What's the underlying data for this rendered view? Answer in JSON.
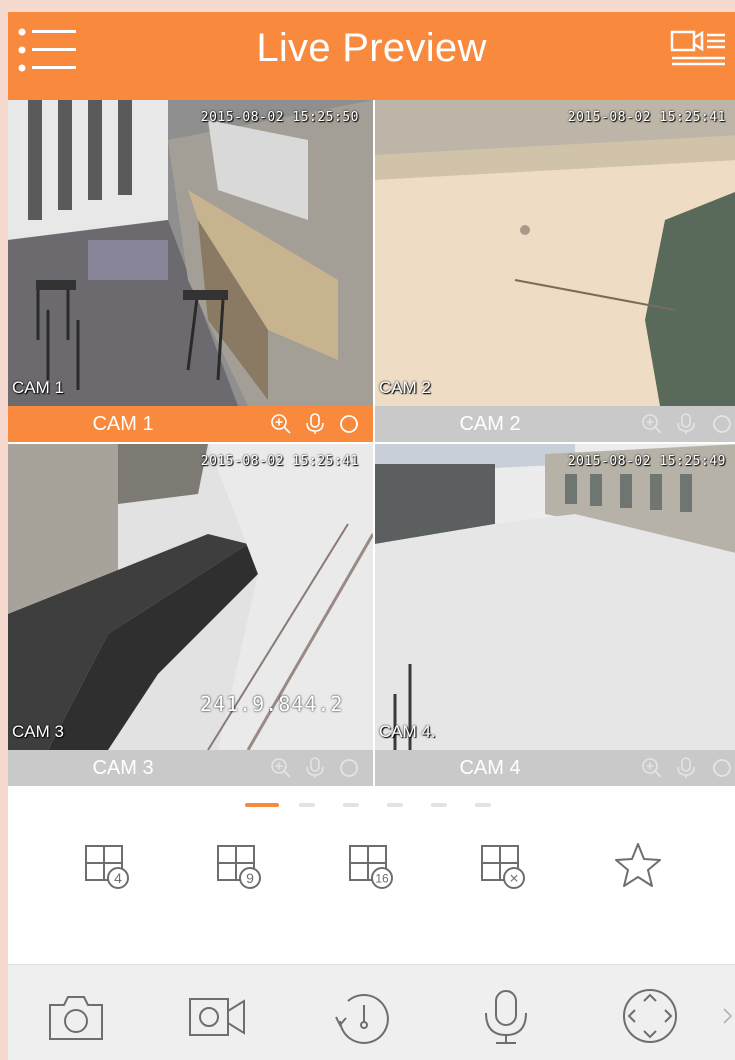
{
  "header": {
    "title": "Live Preview",
    "menu_icon": "hamburger-menu-icon",
    "right_icon": "video-playback-list-icon"
  },
  "colors": {
    "accent": "#f8893d",
    "inactive_bar": "#c9c9c9",
    "icon_gray": "#6e6e6e"
  },
  "cameras": [
    {
      "name": "CAM 1",
      "osd_name": "CAM 1",
      "osd_time": "2015-08-02 15:25:50",
      "active": true,
      "controls": [
        "zoom-in-icon",
        "microphone-icon",
        "circle-icon"
      ]
    },
    {
      "name": "CAM 2",
      "osd_name": "CAM 2",
      "osd_time": "2015-08-02 15:25:41",
      "active": false,
      "controls": [
        "zoom-in-icon",
        "microphone-icon",
        "circle-icon"
      ]
    },
    {
      "name": "CAM 3",
      "osd_name": "CAM 3",
      "osd_time": "2015-08-02 15:25:41",
      "osd_extra": "241.9.844.2",
      "active": false,
      "controls": [
        "zoom-in-icon",
        "microphone-icon",
        "circle-icon"
      ]
    },
    {
      "name": "CAM 4",
      "osd_name": "CAM 4.",
      "osd_time": "2015-08-02 15:25:49",
      "active": false,
      "controls": [
        "zoom-in-icon",
        "microphone-icon",
        "circle-icon"
      ]
    }
  ],
  "pager": {
    "pages": 6,
    "current": 1
  },
  "layout_buttons": [
    {
      "icon": "grid-4-icon",
      "badge": "4"
    },
    {
      "icon": "grid-9-icon",
      "badge": "9"
    },
    {
      "icon": "grid-16-icon",
      "badge": "16"
    },
    {
      "icon": "close-all-icon",
      "badge": "×"
    },
    {
      "icon": "favorite-star-icon",
      "badge": ""
    }
  ],
  "toolbar": [
    {
      "icon": "snapshot-camera-icon"
    },
    {
      "icon": "record-video-icon"
    },
    {
      "icon": "playback-history-icon"
    },
    {
      "icon": "talk-microphone-icon"
    },
    {
      "icon": "ptz-control-icon"
    }
  ],
  "more_icon": "chevron-right-icon"
}
